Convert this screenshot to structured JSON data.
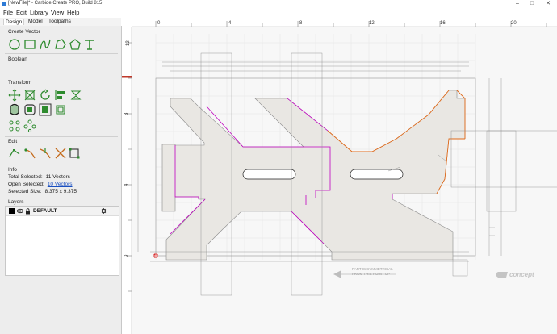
{
  "window": {
    "title": "[NewFile]* - Carbide Create PRO, Build 815",
    "controls": [
      "–",
      "□",
      "✕"
    ]
  },
  "menu": [
    "File",
    "Edit",
    "Library",
    "View",
    "Help"
  ],
  "tabs": [
    "Design",
    "Model",
    "Toolpaths"
  ],
  "sidebar": {
    "create_vector": {
      "title": "Create Vector",
      "tools": [
        "circle-tool-icon",
        "rectangle-tool-icon",
        "curve-tool-icon",
        "polyline-tool-icon",
        "polygon-tool-icon",
        "text-tool-icon"
      ]
    },
    "boolean": {
      "title": "Boolean"
    },
    "transform": {
      "title": "Transform",
      "tools": [
        "move-icon",
        "scale-icon",
        "rotate-icon",
        "align-icon",
        "mirror-icon",
        "offset-icon",
        "join-icon",
        "array-icon",
        "group-icon",
        "circular-array-icon",
        "nodes-array-icon"
      ]
    },
    "edit": {
      "title": "Edit",
      "tools": [
        "node-edit-icon",
        "trim-icon",
        "extend-icon",
        "cut-icon",
        "bounding-box-icon"
      ]
    },
    "info": {
      "title": "Info",
      "total_label": "Total Selected:",
      "total_value": "11 Vectors",
      "open_label": "Open Selected:",
      "open_value": "10 Vectors",
      "size_label": "Selected Size:",
      "size_value": "8.375 x 9.375"
    },
    "layers": {
      "title": "Layers",
      "items": [
        {
          "name": "DEFAULT",
          "color": "#000000"
        }
      ]
    }
  },
  "canvas": {
    "ruler_top": [
      "0",
      "4",
      "8",
      "12",
      "16",
      "20"
    ],
    "ruler_left": [
      "12",
      "8",
      "4",
      "0"
    ],
    "note_line1": "PART IS SYMMETRICAL",
    "note_line2": "FROM THIS POINT UP",
    "logo": "concept",
    "colors": {
      "selected": "#c000c0",
      "highlight": "#e06a1a",
      "fill": "#e9e7e3",
      "grid": "#e4e4e4"
    }
  }
}
